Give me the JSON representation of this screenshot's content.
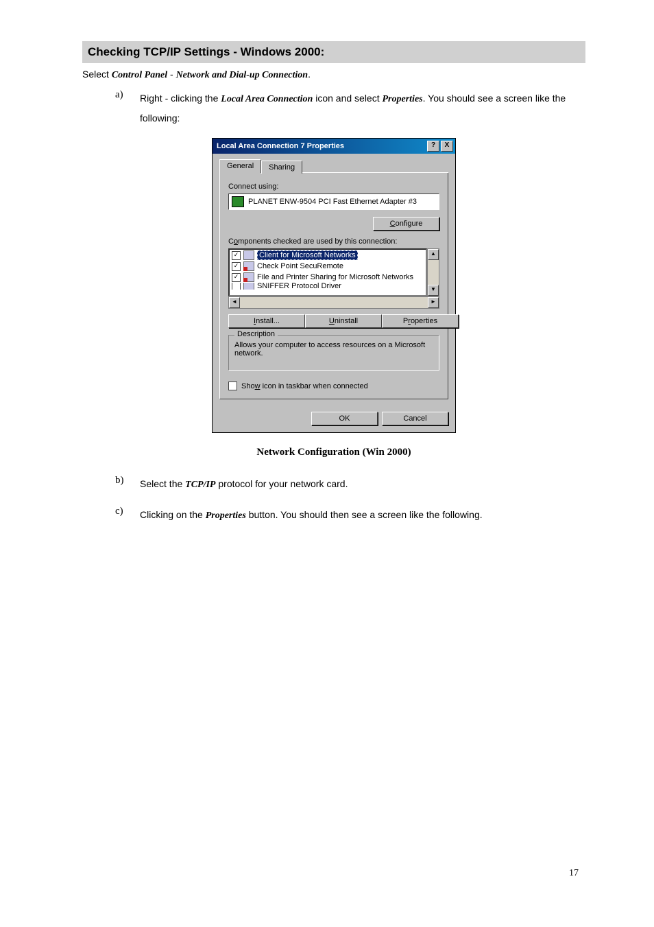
{
  "section_title": "Checking TCP/IP Settings - Windows 2000:",
  "intro": {
    "prefix": "Select ",
    "bold1": "Control Panel",
    "sep": " - ",
    "bold2": "Network and Dial-up Connection",
    "suffix": "."
  },
  "item_a": {
    "marker": "a)",
    "t1": "Right - clicking the ",
    "b1": "Local Area Connection",
    "t2": " icon and select ",
    "b2": "Properties",
    "t3": ". You should see a screen like the following:"
  },
  "dialog": {
    "title": "Local Area Connection 7 Properties",
    "help_btn": "?",
    "close_btn": "X",
    "tabs": {
      "general": "General",
      "sharing": "Sharing"
    },
    "connect_using_label": "Connect using:",
    "adapter_name": "PLANET ENW-9504 PCI Fast Ethernet Adapter #3",
    "configure_btn": "Configure",
    "components_label": "Components checked are used by this connection:",
    "components": {
      "c1": "Client for Microsoft Networks",
      "c2": "Check Point SecuRemote",
      "c3": "File and Printer Sharing for Microsoft Networks",
      "c4": "SNIFFER Protocol Driver"
    },
    "install_btn": "Install...",
    "uninstall_btn": "Uninstall",
    "properties_btn": "Properties",
    "description_legend": "Description",
    "description_text": "Allows your computer to access resources on a Microsoft network.",
    "show_icon_label": "Show icon in taskbar when connected",
    "ok_btn": "OK",
    "cancel_btn": "Cancel"
  },
  "caption": "Network Configuration (Win 2000)",
  "item_b": {
    "marker": "b)",
    "t1": "Select the ",
    "b1": "TCP/IP",
    "t2": " protocol for your network card."
  },
  "item_c": {
    "marker": "c)",
    "t1": "Clicking on the ",
    "b1": "Properties",
    "t2": " button. You should then see a screen like the following."
  },
  "page_number": "17"
}
